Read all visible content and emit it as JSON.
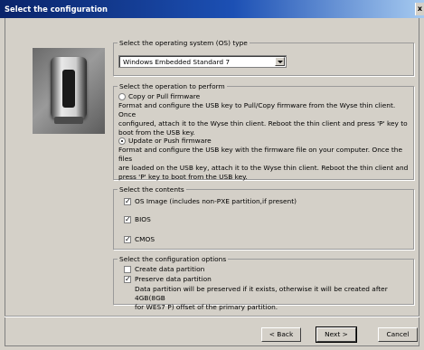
{
  "window": {
    "title": "Select the configuration",
    "close_label": "x"
  },
  "os_group": {
    "legend": "Select the operating system (OS) type",
    "selected": "Windows Embedded Standard 7"
  },
  "operation_group": {
    "legend": "Select the operation to perform",
    "copy": {
      "label": "Copy or Pull firmware",
      "desc1": "Format and configure the USB key to Pull/Copy firmware from the Wyse thin client. Once",
      "desc2": "configured, attach it to the Wyse thin client. Reboot the thin client and press 'P' key to",
      "desc3": "boot from the USB key.",
      "selected": false
    },
    "update": {
      "label": "Update or Push firmware",
      "desc1": "Format and configure the USB key with the firmware file on your computer. Once the files",
      "desc2": "are loaded on the USB key, attach it to the Wyse thin client. Reboot the thin client and",
      "desc3": "press 'P' key to boot from the USB key.",
      "selected": true
    }
  },
  "contents_group": {
    "legend": "Select the contents",
    "items": [
      {
        "label": "OS Image (includes non-PXE partition,if present)",
        "checked": true
      },
      {
        "label": "BIOS",
        "checked": true
      },
      {
        "label": "CMOS",
        "checked": true
      }
    ]
  },
  "options_group": {
    "legend": "Select the configuration options",
    "create": {
      "label": "Create data partition",
      "checked": false
    },
    "preserve": {
      "label": "Preserve data partition",
      "checked": true,
      "desc1": "Data partition will be preserved if it exists, otherwise it will be created after 4GB(8GB",
      "desc2": "for WES7 P) offset of the primary partition."
    }
  },
  "buttons": {
    "back": "< Back",
    "next": "Next >",
    "cancel": "Cancel"
  }
}
